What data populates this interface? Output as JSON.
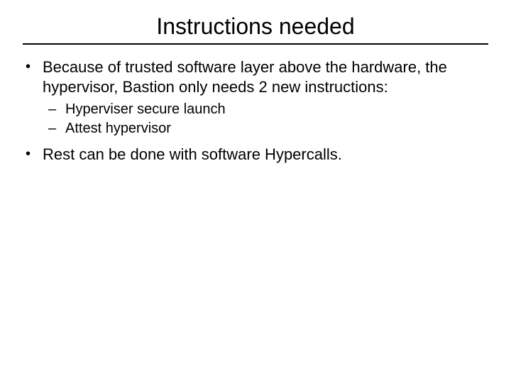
{
  "title": "Instructions needed",
  "bullets": {
    "b1": "Because of trusted software layer above the hardware, the hypervisor, Bastion only needs 2 new instructions:",
    "b1_sub": {
      "s1": "Hyperviser secure launch",
      "s2": "Attest hypervisor"
    },
    "b2": "Rest can be done with software Hypercalls."
  }
}
